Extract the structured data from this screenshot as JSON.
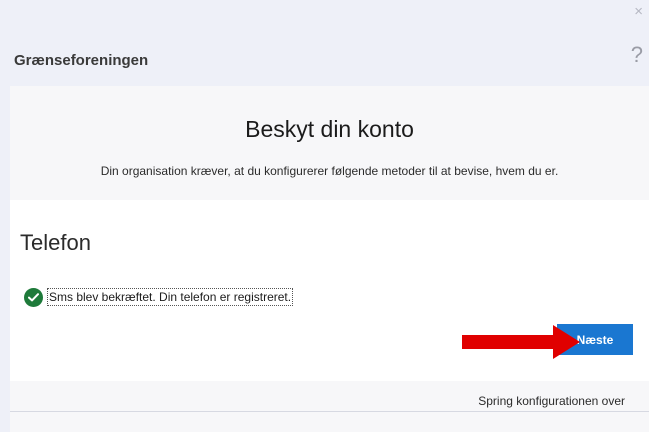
{
  "window": {
    "close_glyph": "×",
    "close_icon": "close-icon"
  },
  "header": {
    "org_name": "Grænseforeningen",
    "help_glyph": "?",
    "help_icon": "help-icon"
  },
  "card": {
    "title": "Beskyt din konto",
    "subtitle": "Din organisation kræver, at du konfigurerer følgende metoder til at bevise, hvem du er."
  },
  "phone_section": {
    "title": "Telefon",
    "status_icon": "check-circle-icon",
    "status_text": "Sms blev bekræftet. Din telefon er registreret."
  },
  "actions": {
    "next_label": "Næste",
    "arrow_icon": "red-arrow-icon"
  },
  "footer": {
    "skip_label": "Spring konfigurationen over"
  },
  "colors": {
    "background": "#eef0f8",
    "primary_button": "#1a77d1",
    "success": "#1e7a3a",
    "annotation_arrow": "#e00000"
  }
}
